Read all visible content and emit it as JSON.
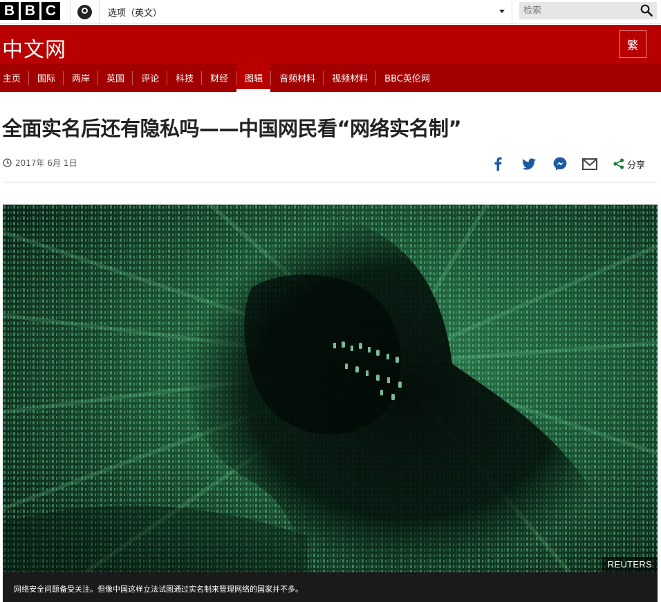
{
  "brand": {
    "letters": [
      "B",
      "B",
      "C"
    ]
  },
  "topbar": {
    "account_icon": "account-icon",
    "language_selected": "选项（英文）",
    "search_placeholder": "检索",
    "search_icon": "search-icon"
  },
  "masthead": {
    "title": "中文网",
    "traditional_button": "繁"
  },
  "nav": {
    "items": [
      {
        "label": "主页",
        "active": false
      },
      {
        "label": "国际",
        "active": false
      },
      {
        "label": "两岸",
        "active": false
      },
      {
        "label": "英国",
        "active": false
      },
      {
        "label": "评论",
        "active": false
      },
      {
        "label": "科技",
        "active": false
      },
      {
        "label": "财经",
        "active": false
      },
      {
        "label": "图辑",
        "active": true
      },
      {
        "label": "音频材料",
        "active": false
      },
      {
        "label": "视频材料",
        "active": false
      },
      {
        "label": "BBC英伦网",
        "active": false
      }
    ]
  },
  "article": {
    "headline": "全面实名后还有隐私吗——中国网民看“网络实名制”",
    "date": "2017年 6月 1日",
    "share": {
      "icons": [
        "facebook-icon",
        "twitter-icon",
        "messenger-icon",
        "email-icon"
      ],
      "label": "分享"
    },
    "image": {
      "credit": "REUTERS",
      "caption": "网络安全问题备受关注。但像中国这样立法试图通过实名制来管理网络的国家并不多。"
    }
  },
  "colors": {
    "masthead_red": "#b80000",
    "nav_red": "#a10000",
    "share_blue": "#1d5aa0",
    "share_green": "#1a7f37"
  }
}
